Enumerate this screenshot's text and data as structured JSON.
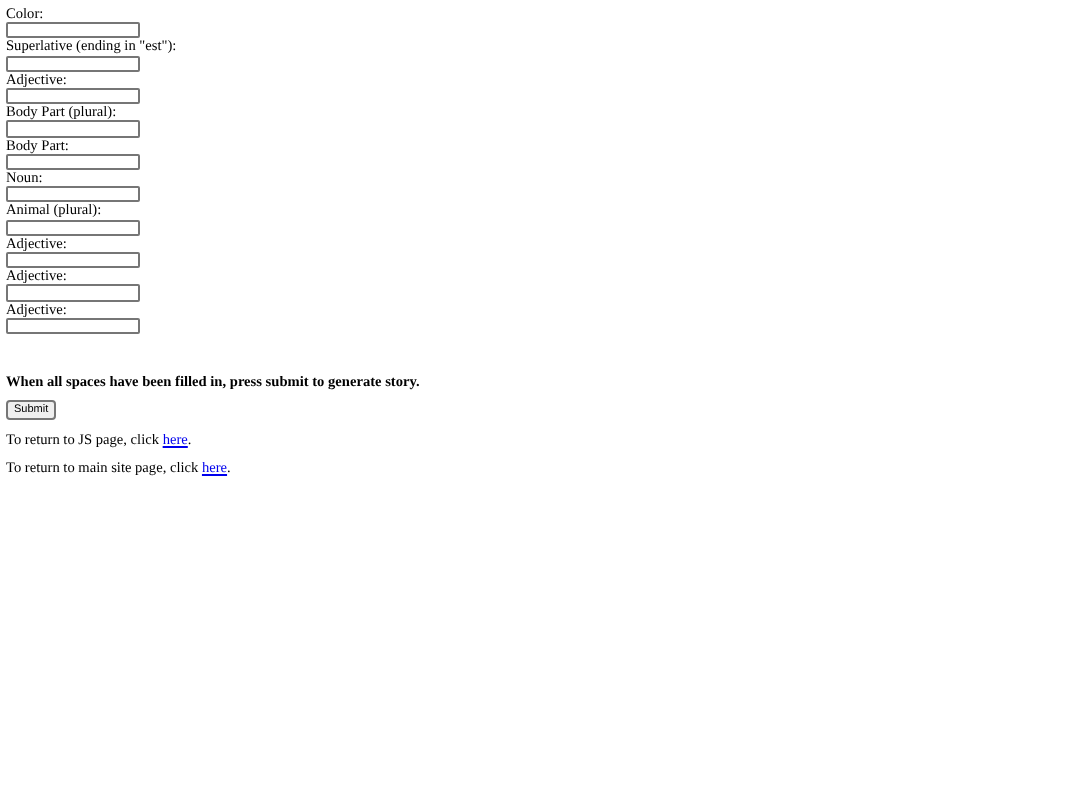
{
  "fields": [
    {
      "label": "Color:"
    },
    {
      "label": "Superlative (ending in \"est\"):"
    },
    {
      "label": "Adjective:"
    },
    {
      "label": "Body Part (plural):"
    },
    {
      "label": "Body Part:"
    },
    {
      "label": "Noun:"
    },
    {
      "label": "Animal (plural):"
    },
    {
      "label": "Adjective:"
    },
    {
      "label": "Adjective:"
    },
    {
      "label": "Adjective:"
    }
  ],
  "instruction": "When all spaces have been filled in, press submit to generate story.",
  "submit_button": "Submit",
  "links": [
    {
      "before": "To return to JS page, click ",
      "link": "here",
      "after": "."
    },
    {
      "before": "To return to main site page, click ",
      "link": "here",
      "after": "."
    }
  ]
}
